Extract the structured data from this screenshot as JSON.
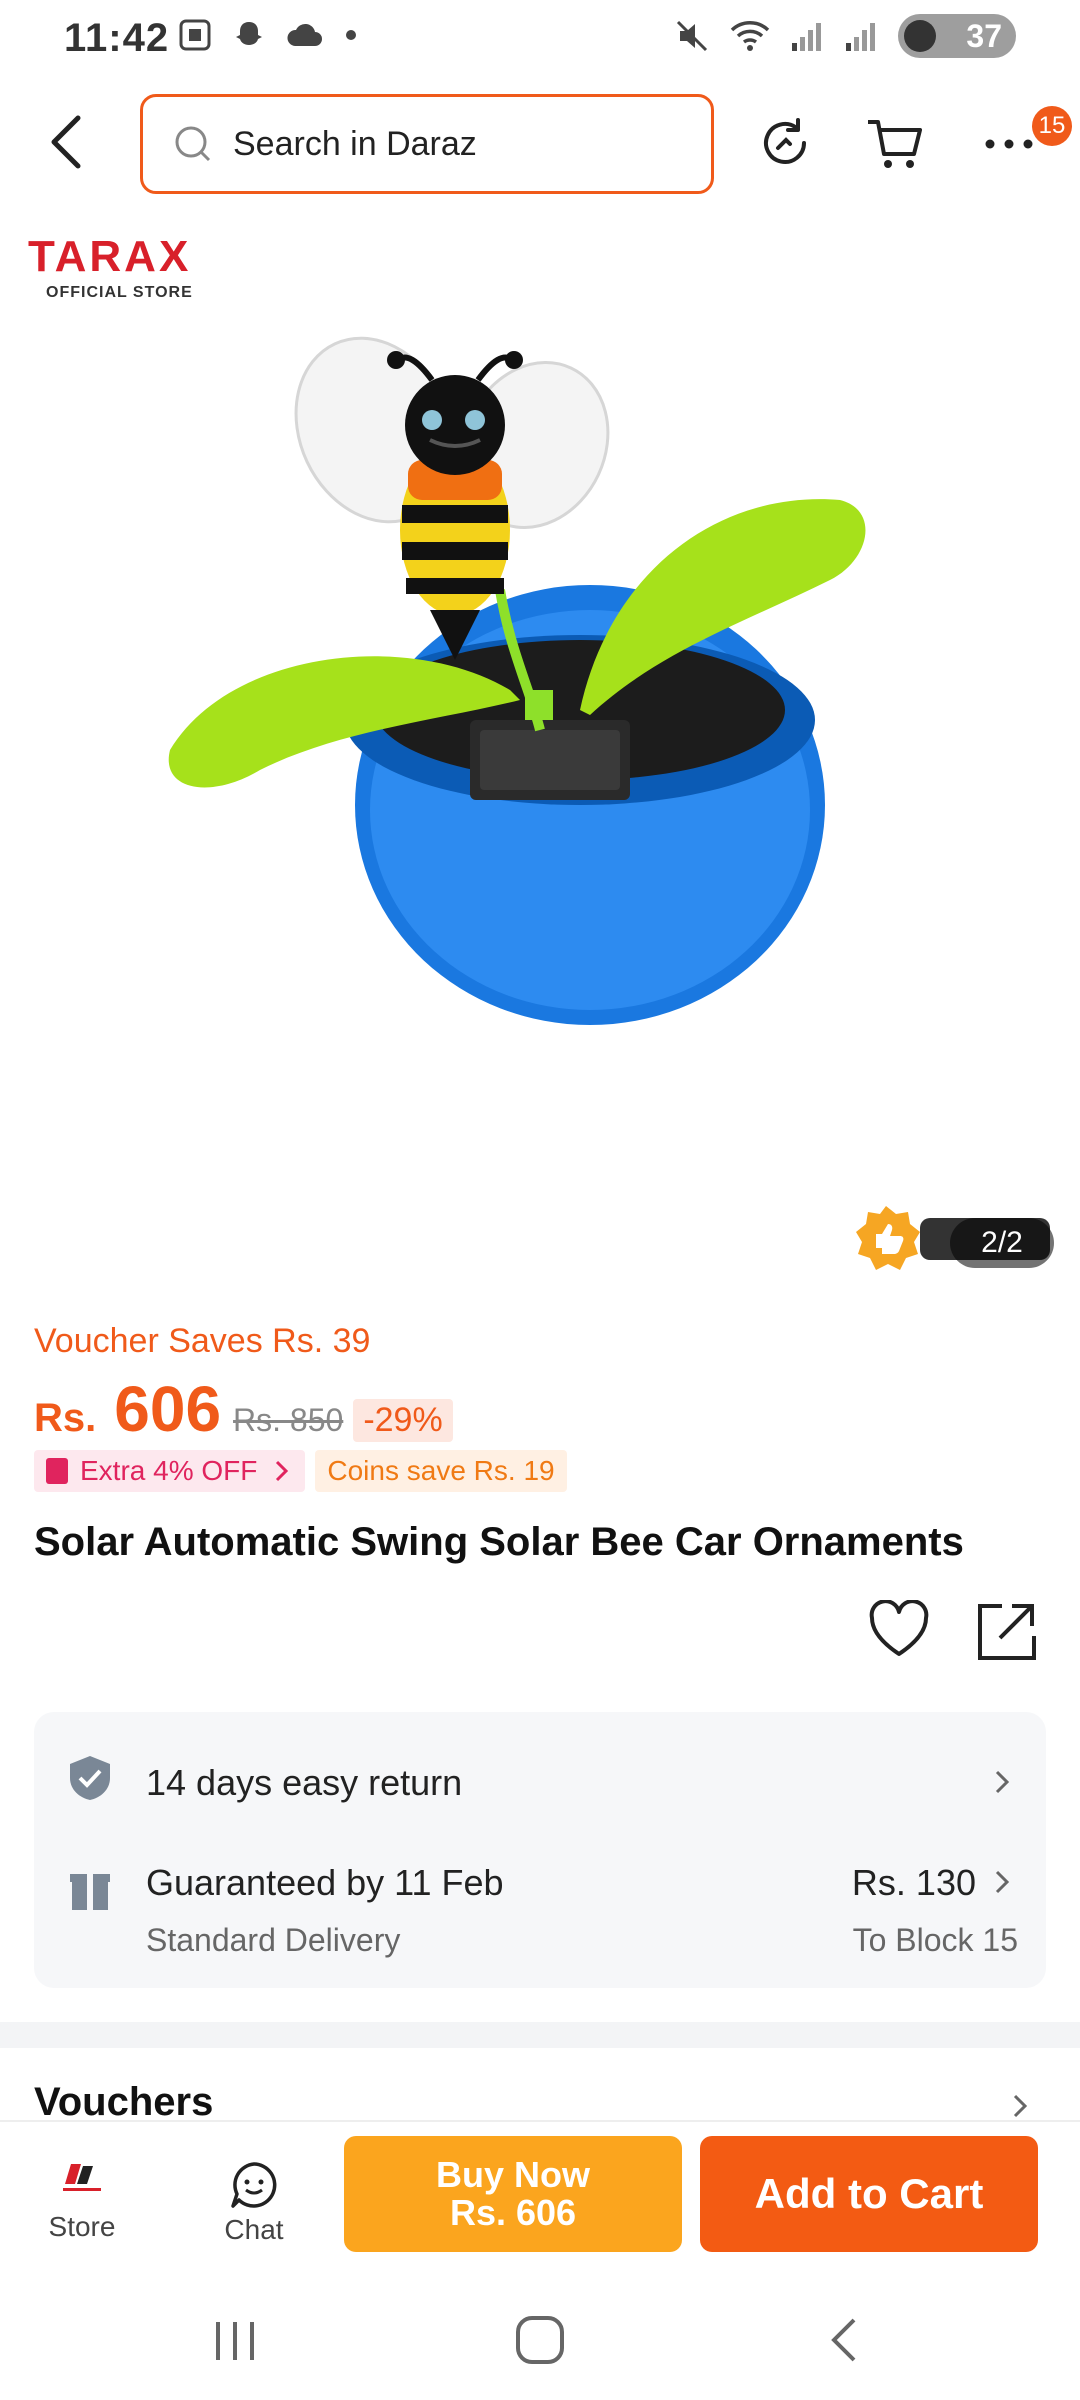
{
  "status_bar": {
    "time": "11:42",
    "battery": "37",
    "left_icons": [
      "screenshot-icon",
      "snapchat-icon",
      "cloud-icon",
      "dot-icon"
    ],
    "right_icons": [
      "mute-icon",
      "wifi-icon",
      "signal-icon",
      "signal-icon",
      "battery-icon"
    ]
  },
  "topnav": {
    "search_placeholder": "Search in Daraz",
    "badge_count": "15"
  },
  "store": {
    "logo_name": "TARAX",
    "logo_sub": "OFFICIAL STORE"
  },
  "product": {
    "image_counter": "2/2",
    "trust_badge": "TRUSTED",
    "voucher_saves": "Voucher Saves Rs. 39",
    "price_currency": "Rs.",
    "price_value": "606",
    "price_old": "Rs. 850",
    "discount": "-29%",
    "promo_extra": "Extra 4% OFF",
    "promo_coins": "Coins save Rs. 19",
    "title": "Solar Automatic Swing Solar Bee Car Ornaments"
  },
  "services": {
    "return_text": "14 days easy return",
    "delivery_text": "Guaranteed by 11 Feb",
    "delivery_sub": "Standard Delivery",
    "delivery_price": "Rs. 130",
    "delivery_location": "To Block 15"
  },
  "sections": {
    "vouchers_title": "Vouchers"
  },
  "action_bar": {
    "store_label": "Store",
    "chat_label": "Chat",
    "buy_now_line1": "Buy Now",
    "buy_now_line2": "Rs. 606",
    "add_to_cart": "Add to Cart"
  },
  "colors": {
    "accent": "#f35b13",
    "buy_now": "#fba51e",
    "promo_pink": "#e0245e",
    "promo_orange": "#f07a14"
  }
}
